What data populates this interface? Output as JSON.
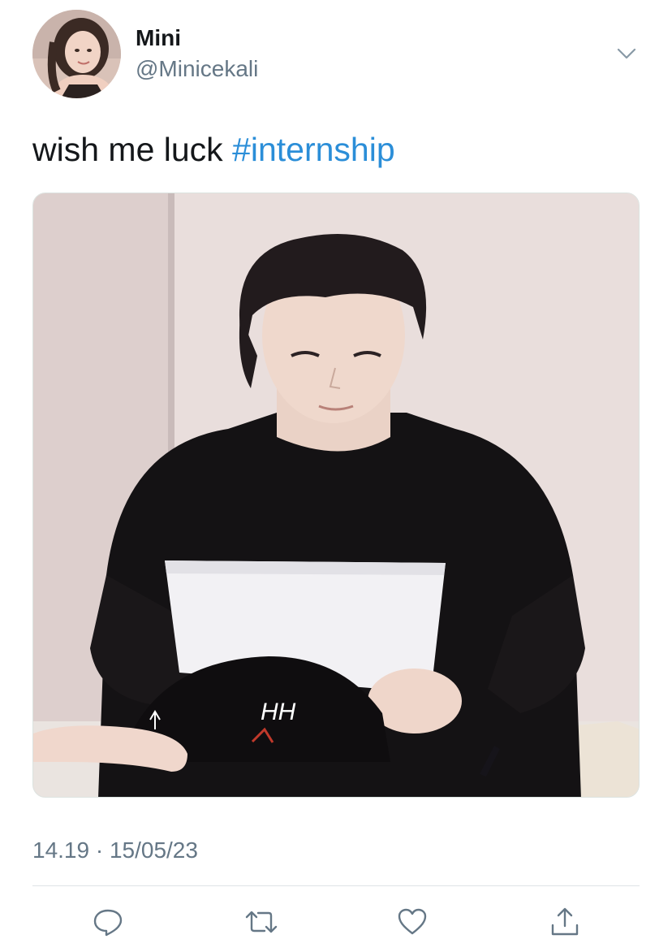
{
  "tweet": {
    "display_name": "Mini",
    "handle": "@Minicekali",
    "text": "wish me luck ",
    "hashtag": "#internship",
    "timestamp": "14.19 · 15/05/23"
  },
  "media": {
    "paper_glyph": "HH"
  },
  "icons": {
    "more": "chevron-down-icon",
    "reply": "reply-icon",
    "retweet": "retweet-icon",
    "like": "heart-icon",
    "share": "share-icon"
  },
  "colors": {
    "text": "#14171a",
    "secondary": "#657786",
    "hashtag": "#2b8ed8",
    "divider": "#dfe3e6"
  }
}
